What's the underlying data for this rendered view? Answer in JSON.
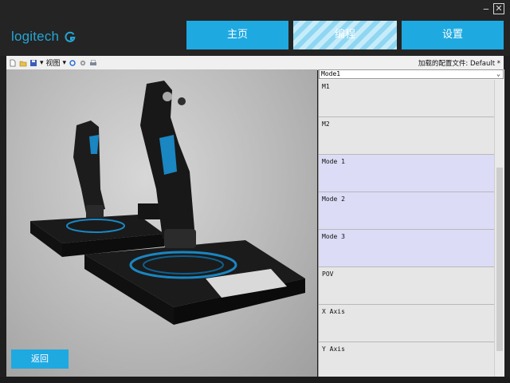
{
  "app": {
    "logo_text": "logitech"
  },
  "nav": {
    "home": "主页",
    "program": "编程",
    "settings": "设置"
  },
  "window": {
    "minimize": "‒",
    "close": "✕"
  },
  "toolbar": {
    "view_label": "视图",
    "loaded_config": "加载的配置文件: Default *"
  },
  "panel": {
    "mode_select": "Mode1",
    "rows": [
      "M1",
      "M2",
      "Mode 1",
      "Mode 2",
      "Mode 3",
      "POV",
      "X Axis",
      "Y Axis"
    ]
  },
  "actions": {
    "back": "返回"
  },
  "colors": {
    "accent": "#1fa9e1",
    "mode_row": "#dcdcf6"
  }
}
